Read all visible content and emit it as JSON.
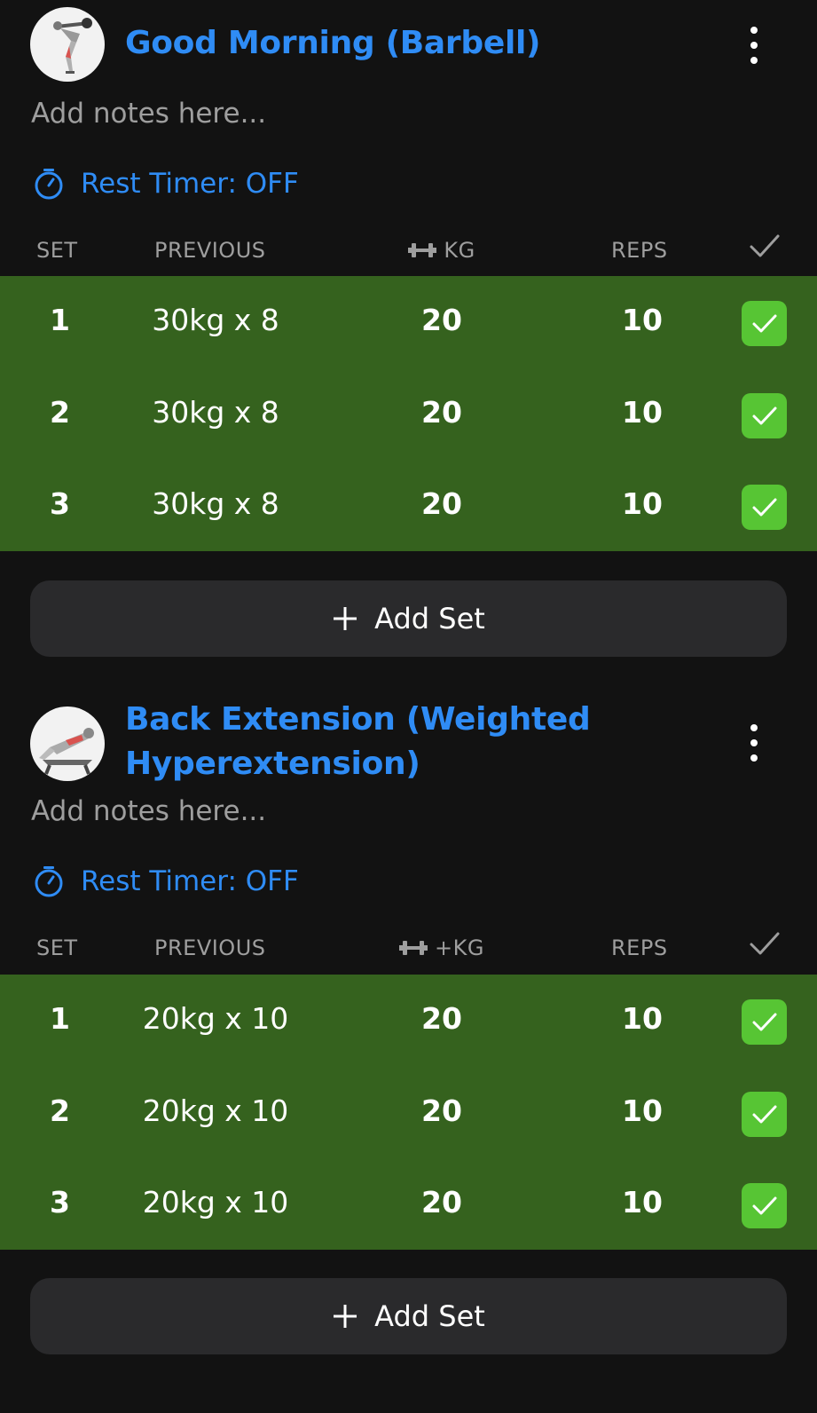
{
  "colors": {
    "accent": "#2f8cf5",
    "completed_row": "#35621e",
    "check_bg": "#57c534",
    "background": "#121212",
    "button_bg": "#2a2a2c"
  },
  "exercises": [
    {
      "title_line1": "Good Morning (Barbell)",
      "title_line2": "",
      "notes_placeholder": "Add notes here...",
      "rest_timer": "Rest Timer: OFF",
      "headers": {
        "set": "SET",
        "previous": "PREVIOUS",
        "kg": "KG",
        "reps": "REPS"
      },
      "sets": [
        {
          "set": "1",
          "previous": "30kg x 8",
          "kg": "20",
          "reps": "10",
          "done": true
        },
        {
          "set": "2",
          "previous": "30kg x 8",
          "kg": "20",
          "reps": "10",
          "done": true
        },
        {
          "set": "3",
          "previous": "30kg x 8",
          "kg": "20",
          "reps": "10",
          "done": true
        }
      ],
      "add_set": "Add Set"
    },
    {
      "title_line1": "Back Extension (Weighted",
      "title_line2": "Hyperextension)",
      "notes_placeholder": "Add notes here...",
      "rest_timer": "Rest Timer: OFF",
      "headers": {
        "set": "SET",
        "previous": "PREVIOUS",
        "kg": "+KG",
        "reps": "REPS"
      },
      "sets": [
        {
          "set": "1",
          "previous": "20kg x 10",
          "kg": "20",
          "reps": "10",
          "done": true
        },
        {
          "set": "2",
          "previous": "20kg x 10",
          "kg": "20",
          "reps": "10",
          "done": true
        },
        {
          "set": "3",
          "previous": "20kg x 10",
          "kg": "20",
          "reps": "10",
          "done": true
        }
      ],
      "add_set": "Add Set"
    }
  ]
}
